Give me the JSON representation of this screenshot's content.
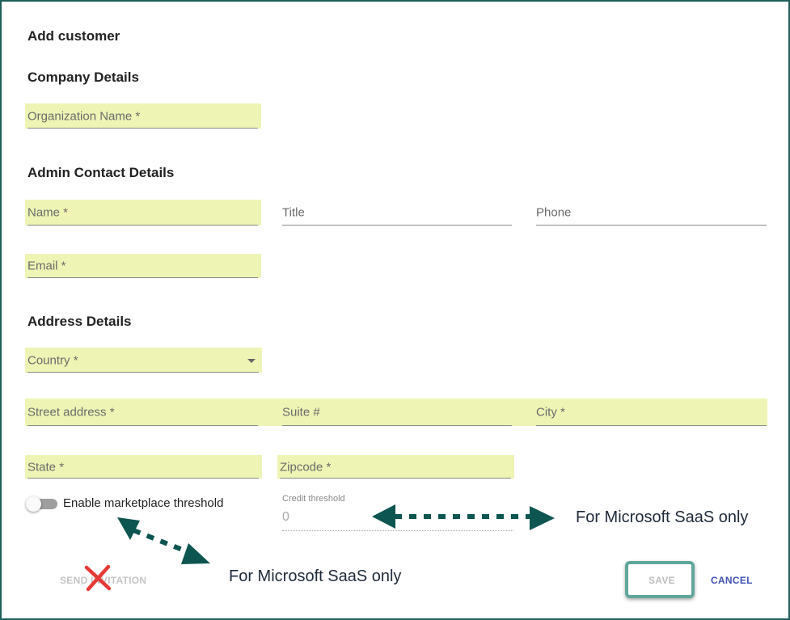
{
  "dialog": {
    "title": "Add customer"
  },
  "sections": {
    "company": "Company Details",
    "admin": "Admin Contact Details",
    "address": "Address Details"
  },
  "fields": {
    "organization_name": "Organization Name *",
    "name": "Name *",
    "title": "Title",
    "phone": "Phone",
    "email": "Email *",
    "country": "Country *",
    "street_address": "Street address *",
    "suite": "Suite #",
    "city": "City *",
    "state": "State *",
    "zipcode": "Zipcode *"
  },
  "marketplace": {
    "toggle_label": "Enable marketplace threshold",
    "toggle_on": false,
    "credit_label": "Credit threshold",
    "credit_value": "0"
  },
  "annotations": {
    "note_right": "For Microsoft SaaS only",
    "note_bottom": "For Microsoft SaaS only"
  },
  "actions": {
    "send_invitation": "SEND INVITATION",
    "save": "SAVE",
    "cancel": "CANCEL"
  },
  "colors": {
    "highlight": "#eef4b4",
    "annotation_arrow": "#0d5550",
    "save_outline": "#5fa79b",
    "cancel": "#3f51b5",
    "cross": "#e53935"
  }
}
